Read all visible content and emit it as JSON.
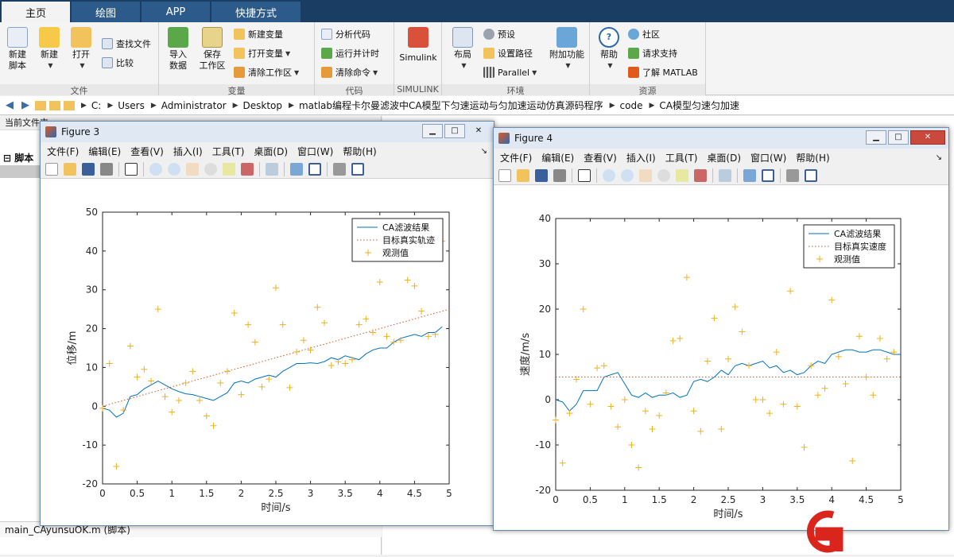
{
  "tabs": [
    {
      "label": "主页",
      "active": true
    },
    {
      "label": "绘图",
      "active": false
    },
    {
      "label": "APP",
      "active": false
    },
    {
      "label": "快捷方式",
      "active": false
    }
  ],
  "ribbon": {
    "file": {
      "label": "文件",
      "new_script": "新建\n脚本",
      "new": "新建",
      "open": "打开",
      "find_files": "查找文件",
      "compare": "比较"
    },
    "variable": {
      "label": "变量",
      "import": "导入\n数据",
      "save_ws": "保存\n工作区",
      "new_var": "新建变量",
      "open_var": "打开变量",
      "clear_ws": "清除工作区"
    },
    "code": {
      "label": "代码",
      "analyze": "分析代码",
      "run_time": "运行并计时",
      "clear_cmd": "清除命令"
    },
    "simulink": {
      "label": "SIMULINK",
      "simulink": "Simulink"
    },
    "env": {
      "label": "环境",
      "layout": "布局",
      "prefs": "预设",
      "set_path": "设置路径",
      "parallel": "Parallel",
      "addons": "附加功能"
    },
    "resources": {
      "label": "资源",
      "help": "帮助",
      "community": "社区",
      "support": "请求支持",
      "learn": "了解 MATLAB"
    }
  },
  "address": {
    "crumbs": [
      "C:",
      "Users",
      "Administrator",
      "Desktop",
      "matlab编程卡尔曼滤波中CA模型下匀速运动与匀加速运动仿真源码程序",
      "code",
      "CA模型匀速匀加速"
    ]
  },
  "left_panel": {
    "title": "当前文件夹",
    "item_label": "脚本",
    "bottom_file": "main_CAyunsuOK.m  (脚本)"
  },
  "figure3": {
    "title": "Figure 3",
    "menus": [
      "文件(F)",
      "编辑(E)",
      "查看(V)",
      "插入(I)",
      "工具(T)",
      "桌面(D)",
      "窗口(W)",
      "帮助(H)"
    ]
  },
  "figure4": {
    "title": "Figure 4",
    "menus": [
      "文件(F)",
      "编辑(E)",
      "查看(V)",
      "插入(I)",
      "工具(T)",
      "桌面(D)",
      "窗口(W)",
      "帮助(H)"
    ]
  },
  "colors": {
    "filter": "#0072bd",
    "truth": "#d95319",
    "obs": "#edb120",
    "ribbon_dark": "#1a3d63"
  },
  "chart_data": [
    {
      "type": "line",
      "xlabel": "时间/s",
      "ylabel": "位移/m",
      "xlim": [
        0,
        5
      ],
      "ylim": [
        -20,
        50
      ],
      "xticks": [
        0,
        0.5,
        1,
        1.5,
        2,
        2.5,
        3,
        3.5,
        4,
        4.5,
        5
      ],
      "yticks": [
        -20,
        -10,
        0,
        10,
        20,
        30,
        40,
        50
      ],
      "legend_position": "top-right",
      "series": [
        {
          "name": "CA滤波结果",
          "style": "solid",
          "x": [
            0,
            0.1,
            0.2,
            0.3,
            0.4,
            0.5,
            0.6,
            0.7,
            0.8,
            0.9,
            1.0,
            1.1,
            1.2,
            1.3,
            1.4,
            1.5,
            1.6,
            1.7,
            1.8,
            1.9,
            2.0,
            2.1,
            2.2,
            2.3,
            2.4,
            2.5,
            2.6,
            2.7,
            2.8,
            2.9,
            3.0,
            3.1,
            3.2,
            3.3,
            3.4,
            3.5,
            3.6,
            3.7,
            3.8,
            3.9,
            4.0,
            4.1,
            4.2,
            4.3,
            4.4,
            4.5,
            4.6,
            4.7,
            4.8,
            4.9
          ],
          "y": [
            -0.5,
            -1.0,
            -2.8,
            -1.8,
            2.5,
            3.0,
            4.5,
            5.5,
            6.5,
            5.5,
            4.5,
            3.8,
            3.2,
            3.0,
            2.5,
            2.0,
            1.5,
            2.5,
            3.5,
            6.0,
            6.5,
            6.0,
            7.0,
            7.5,
            8.0,
            7.5,
            9.0,
            10.0,
            11.0,
            11.0,
            11.2,
            11.0,
            11.5,
            12.5,
            12.0,
            13.0,
            12.5,
            12.0,
            13.5,
            14.5,
            15.0,
            15.0,
            16.5,
            17.5,
            18.0,
            18.5,
            18.0,
            19.0,
            19.0,
            20.5
          ]
        },
        {
          "name": "目标真实轨迹",
          "style": "dotted",
          "x": [
            0,
            5
          ],
          "y": [
            0,
            25
          ]
        },
        {
          "name": "观测值",
          "style": "plus",
          "x": [
            0,
            0.1,
            0.2,
            0.3,
            0.4,
            0.5,
            0.6,
            0.7,
            0.8,
            0.9,
            1.0,
            1.1,
            1.2,
            1.3,
            1.4,
            1.5,
            1.6,
            1.7,
            1.8,
            1.9,
            2.0,
            2.1,
            2.2,
            2.3,
            2.4,
            2.5,
            2.6,
            2.7,
            2.8,
            2.9,
            3.0,
            3.1,
            3.2,
            3.3,
            3.4,
            3.5,
            3.6,
            3.7,
            3.8,
            3.9,
            4.0,
            4.1,
            4.2,
            4.3,
            4.4,
            4.5,
            4.6,
            4.7,
            4.8,
            4.9
          ],
          "y": [
            -0.5,
            11.0,
            -15.5,
            -1.0,
            15.5,
            7.5,
            9.5,
            6.5,
            25.0,
            2.5,
            -1.5,
            1.5,
            6.0,
            9.0,
            1.5,
            -2.5,
            -5.0,
            6.0,
            9.0,
            24.0,
            3.0,
            21.0,
            16.5,
            5.0,
            7.0,
            30.5,
            21.0,
            4.8,
            14.0,
            17.0,
            14.5,
            25.5,
            21.5,
            10.5,
            11.5,
            11.0,
            12.0,
            21.0,
            22.5,
            19.0,
            32.0,
            18.0,
            16.5,
            17.0,
            32.5,
            31.0,
            24.5,
            18.0,
            18.5,
            42.5
          ]
        }
      ]
    },
    {
      "type": "line",
      "xlabel": "时间/s",
      "ylabel": "速度/m/s",
      "xlim": [
        0,
        5
      ],
      "ylim": [
        -20,
        40
      ],
      "xticks": [
        0,
        0.5,
        1,
        1.5,
        2,
        2.5,
        3,
        3.5,
        4,
        4.5,
        5
      ],
      "yticks": [
        -20,
        -10,
        0,
        10,
        20,
        30,
        40
      ],
      "legend_position": "top-right",
      "series": [
        {
          "name": "CA滤波结果",
          "style": "solid",
          "x": [
            0,
            0.1,
            0.2,
            0.3,
            0.4,
            0.5,
            0.6,
            0.7,
            0.8,
            0.9,
            1.0,
            1.1,
            1.2,
            1.3,
            1.4,
            1.5,
            1.6,
            1.7,
            1.8,
            1.9,
            2.0,
            2.1,
            2.2,
            2.3,
            2.4,
            2.5,
            2.6,
            2.7,
            2.8,
            2.9,
            3.0,
            3.1,
            3.2,
            3.3,
            3.4,
            3.5,
            3.6,
            3.7,
            3.8,
            3.9,
            4.0,
            4.1,
            4.2,
            4.3,
            4.4,
            4.5,
            4.6,
            4.7,
            4.8,
            4.9,
            5.0
          ],
          "y": [
            0,
            -0.5,
            -2.5,
            -1.0,
            2.0,
            2.0,
            2.0,
            5.0,
            5.5,
            6.0,
            3.5,
            1.0,
            0.5,
            1.5,
            0.5,
            1.0,
            1.0,
            1.5,
            0.5,
            1.0,
            4.0,
            4.5,
            4.0,
            5.0,
            6.5,
            5.5,
            7.5,
            8.0,
            7.5,
            8.0,
            8.5,
            7.0,
            7.5,
            6.0,
            6.5,
            5.5,
            6.0,
            7.5,
            8.5,
            8.0,
            10.0,
            10.5,
            11.0,
            11.0,
            10.5,
            10.5,
            11.0,
            11.0,
            10.5,
            10.0,
            10.0
          ]
        },
        {
          "name": "目标真实速度",
          "style": "dotted",
          "x": [
            0,
            5
          ],
          "y": [
            5,
            5
          ]
        },
        {
          "name": "观测值",
          "style": "plus",
          "x": [
            0,
            0.1,
            0.2,
            0.3,
            0.4,
            0.5,
            0.6,
            0.7,
            0.8,
            0.9,
            1.0,
            1.1,
            1.2,
            1.3,
            1.4,
            1.5,
            1.6,
            1.7,
            1.8,
            1.9,
            2.0,
            2.1,
            2.2,
            2.3,
            2.4,
            2.5,
            2.6,
            2.7,
            2.8,
            2.9,
            3.0,
            3.1,
            3.2,
            3.3,
            3.4,
            3.5,
            3.6,
            3.7,
            3.8,
            3.9,
            4.0,
            4.1,
            4.2,
            4.3,
            4.4,
            4.5,
            4.6,
            4.7,
            4.8,
            4.9
          ],
          "y": [
            -4.5,
            -14.0,
            -3.0,
            4.5,
            20.0,
            -1.0,
            7.0,
            7.5,
            -1.5,
            -6.0,
            0.0,
            -10.0,
            -15.0,
            -2.5,
            -6.5,
            -3.5,
            1.5,
            13.0,
            13.5,
            27.0,
            -2.5,
            -7.0,
            8.5,
            18.0,
            -6.5,
            9.0,
            20.5,
            15.0,
            7.5,
            0.0,
            0.0,
            -3.0,
            10.5,
            -1.0,
            24.0,
            -1.5,
            -10.5,
            7.5,
            1.0,
            2.5,
            22.0,
            9.5,
            3.5,
            -13.5,
            14.0,
            5.0,
            1.0,
            13.5,
            9.0,
            10.5
          ]
        }
      ]
    }
  ]
}
